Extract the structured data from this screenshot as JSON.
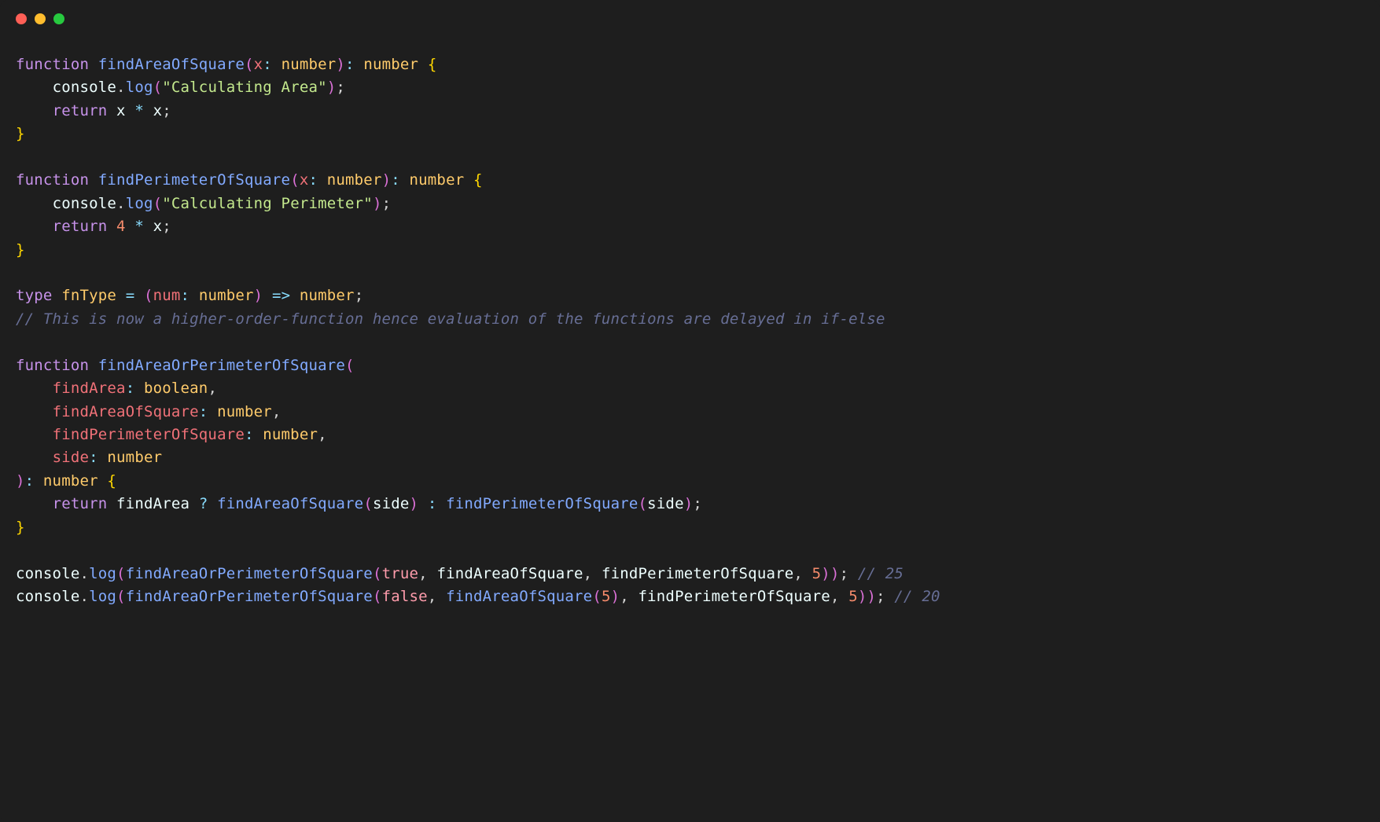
{
  "window": {
    "traffic_lights": [
      "close",
      "minimize",
      "zoom"
    ]
  },
  "code": {
    "language": "typescript",
    "lines": [
      [
        {
          "t": "function",
          "c": "kw"
        },
        {
          "t": " ",
          "c": "ws"
        },
        {
          "t": "findAreaOfSquare",
          "c": "fn"
        },
        {
          "t": "(",
          "c": "punc paren"
        },
        {
          "t": "x",
          "c": "param"
        },
        {
          "t": ":",
          "c": "op"
        },
        {
          "t": " ",
          "c": "ws"
        },
        {
          "t": "number",
          "c": "type"
        },
        {
          "t": ")",
          "c": "punc paren"
        },
        {
          "t": ":",
          "c": "op"
        },
        {
          "t": " ",
          "c": "ws"
        },
        {
          "t": "number",
          "c": "type"
        },
        {
          "t": " ",
          "c": "ws"
        },
        {
          "t": "{",
          "c": "punc brace"
        }
      ],
      [
        {
          "t": "    ",
          "c": "ws"
        },
        {
          "t": "console",
          "c": "obj"
        },
        {
          "t": ".",
          "c": "punc"
        },
        {
          "t": "log",
          "c": "fn"
        },
        {
          "t": "(",
          "c": "punc paren"
        },
        {
          "t": "\"Calculating Area\"",
          "c": "str"
        },
        {
          "t": ")",
          "c": "punc paren"
        },
        {
          "t": ";",
          "c": "punc"
        }
      ],
      [
        {
          "t": "    ",
          "c": "ws"
        },
        {
          "t": "return",
          "c": "kw"
        },
        {
          "t": " ",
          "c": "ws"
        },
        {
          "t": "x",
          "c": "var"
        },
        {
          "t": " ",
          "c": "ws"
        },
        {
          "t": "*",
          "c": "op"
        },
        {
          "t": " ",
          "c": "ws"
        },
        {
          "t": "x",
          "c": "var"
        },
        {
          "t": ";",
          "c": "punc"
        }
      ],
      [
        {
          "t": "}",
          "c": "punc brace"
        }
      ],
      [],
      [
        {
          "t": "function",
          "c": "kw"
        },
        {
          "t": " ",
          "c": "ws"
        },
        {
          "t": "findPerimeterOfSquare",
          "c": "fn"
        },
        {
          "t": "(",
          "c": "punc paren"
        },
        {
          "t": "x",
          "c": "param"
        },
        {
          "t": ":",
          "c": "op"
        },
        {
          "t": " ",
          "c": "ws"
        },
        {
          "t": "number",
          "c": "type"
        },
        {
          "t": ")",
          "c": "punc paren"
        },
        {
          "t": ":",
          "c": "op"
        },
        {
          "t": " ",
          "c": "ws"
        },
        {
          "t": "number",
          "c": "type"
        },
        {
          "t": " ",
          "c": "ws"
        },
        {
          "t": "{",
          "c": "punc brace"
        }
      ],
      [
        {
          "t": "    ",
          "c": "ws"
        },
        {
          "t": "console",
          "c": "obj"
        },
        {
          "t": ".",
          "c": "punc"
        },
        {
          "t": "log",
          "c": "fn"
        },
        {
          "t": "(",
          "c": "punc paren"
        },
        {
          "t": "\"Calculating Perimeter\"",
          "c": "str"
        },
        {
          "t": ")",
          "c": "punc paren"
        },
        {
          "t": ";",
          "c": "punc"
        }
      ],
      [
        {
          "t": "    ",
          "c": "ws"
        },
        {
          "t": "return",
          "c": "kw"
        },
        {
          "t": " ",
          "c": "ws"
        },
        {
          "t": "4",
          "c": "num"
        },
        {
          "t": " ",
          "c": "ws"
        },
        {
          "t": "*",
          "c": "op"
        },
        {
          "t": " ",
          "c": "ws"
        },
        {
          "t": "x",
          "c": "var"
        },
        {
          "t": ";",
          "c": "punc"
        }
      ],
      [
        {
          "t": "}",
          "c": "punc brace"
        }
      ],
      [],
      [
        {
          "t": "type",
          "c": "kw"
        },
        {
          "t": " ",
          "c": "ws"
        },
        {
          "t": "fnType",
          "c": "type"
        },
        {
          "t": " ",
          "c": "ws"
        },
        {
          "t": "=",
          "c": "op"
        },
        {
          "t": " ",
          "c": "ws"
        },
        {
          "t": "(",
          "c": "punc paren"
        },
        {
          "t": "num",
          "c": "param"
        },
        {
          "t": ":",
          "c": "op"
        },
        {
          "t": " ",
          "c": "ws"
        },
        {
          "t": "number",
          "c": "type"
        },
        {
          "t": ")",
          "c": "punc paren"
        },
        {
          "t": " ",
          "c": "ws"
        },
        {
          "t": "=>",
          "c": "op"
        },
        {
          "t": " ",
          "c": "ws"
        },
        {
          "t": "number",
          "c": "type"
        },
        {
          "t": ";",
          "c": "punc"
        }
      ],
      [
        {
          "t": "// This is now a higher-order-function hence evaluation of the functions are delayed in if-else",
          "c": "comment"
        }
      ],
      [],
      [
        {
          "t": "function",
          "c": "kw"
        },
        {
          "t": " ",
          "c": "ws"
        },
        {
          "t": "findAreaOrPerimeterOfSquare",
          "c": "fn"
        },
        {
          "t": "(",
          "c": "punc paren"
        }
      ],
      [
        {
          "t": "    ",
          "c": "ws"
        },
        {
          "t": "findArea",
          "c": "param"
        },
        {
          "t": ":",
          "c": "op"
        },
        {
          "t": " ",
          "c": "ws"
        },
        {
          "t": "boolean",
          "c": "type"
        },
        {
          "t": ",",
          "c": "punc"
        }
      ],
      [
        {
          "t": "    ",
          "c": "ws"
        },
        {
          "t": "findAreaOfSquare",
          "c": "param"
        },
        {
          "t": ":",
          "c": "op"
        },
        {
          "t": " ",
          "c": "ws"
        },
        {
          "t": "number",
          "c": "type"
        },
        {
          "t": ",",
          "c": "punc"
        }
      ],
      [
        {
          "t": "    ",
          "c": "ws"
        },
        {
          "t": "findPerimeterOfSquare",
          "c": "param"
        },
        {
          "t": ":",
          "c": "op"
        },
        {
          "t": " ",
          "c": "ws"
        },
        {
          "t": "number",
          "c": "type"
        },
        {
          "t": ",",
          "c": "punc"
        }
      ],
      [
        {
          "t": "    ",
          "c": "ws"
        },
        {
          "t": "side",
          "c": "param"
        },
        {
          "t": ":",
          "c": "op"
        },
        {
          "t": " ",
          "c": "ws"
        },
        {
          "t": "number",
          "c": "type"
        }
      ],
      [
        {
          "t": ")",
          "c": "punc paren"
        },
        {
          "t": ":",
          "c": "op"
        },
        {
          "t": " ",
          "c": "ws"
        },
        {
          "t": "number",
          "c": "type"
        },
        {
          "t": " ",
          "c": "ws"
        },
        {
          "t": "{",
          "c": "punc brace"
        }
      ],
      [
        {
          "t": "    ",
          "c": "ws"
        },
        {
          "t": "return",
          "c": "kw"
        },
        {
          "t": " ",
          "c": "ws"
        },
        {
          "t": "findArea",
          "c": "var"
        },
        {
          "t": " ",
          "c": "ws"
        },
        {
          "t": "?",
          "c": "op"
        },
        {
          "t": " ",
          "c": "ws"
        },
        {
          "t": "findAreaOfSquare",
          "c": "fn"
        },
        {
          "t": "(",
          "c": "punc paren"
        },
        {
          "t": "side",
          "c": "var"
        },
        {
          "t": ")",
          "c": "punc paren"
        },
        {
          "t": " ",
          "c": "ws"
        },
        {
          "t": ":",
          "c": "op"
        },
        {
          "t": " ",
          "c": "ws"
        },
        {
          "t": "findPerimeterOfSquare",
          "c": "fn"
        },
        {
          "t": "(",
          "c": "punc paren"
        },
        {
          "t": "side",
          "c": "var"
        },
        {
          "t": ")",
          "c": "punc paren"
        },
        {
          "t": ";",
          "c": "punc"
        }
      ],
      [
        {
          "t": "}",
          "c": "punc brace"
        }
      ],
      [],
      [
        {
          "t": "console",
          "c": "obj"
        },
        {
          "t": ".",
          "c": "punc"
        },
        {
          "t": "log",
          "c": "fn"
        },
        {
          "t": "(",
          "c": "punc paren"
        },
        {
          "t": "findAreaOrPerimeterOfSquare",
          "c": "fn"
        },
        {
          "t": "(",
          "c": "punc paren"
        },
        {
          "t": "true",
          "c": "bool"
        },
        {
          "t": ",",
          "c": "punc"
        },
        {
          "t": " ",
          "c": "ws"
        },
        {
          "t": "findAreaOfSquare",
          "c": "var"
        },
        {
          "t": ",",
          "c": "punc"
        },
        {
          "t": " ",
          "c": "ws"
        },
        {
          "t": "findPerimeterOfSquare",
          "c": "var"
        },
        {
          "t": ",",
          "c": "punc"
        },
        {
          "t": " ",
          "c": "ws"
        },
        {
          "t": "5",
          "c": "num"
        },
        {
          "t": ")",
          "c": "punc paren"
        },
        {
          "t": ")",
          "c": "punc paren"
        },
        {
          "t": ";",
          "c": "punc"
        },
        {
          "t": " ",
          "c": "ws"
        },
        {
          "t": "// 25",
          "c": "comment"
        }
      ],
      [
        {
          "t": "console",
          "c": "obj"
        },
        {
          "t": ".",
          "c": "punc"
        },
        {
          "t": "log",
          "c": "fn"
        },
        {
          "t": "(",
          "c": "punc paren"
        },
        {
          "t": "findAreaOrPerimeterOfSquare",
          "c": "fn"
        },
        {
          "t": "(",
          "c": "punc paren"
        },
        {
          "t": "false",
          "c": "bool"
        },
        {
          "t": ",",
          "c": "punc"
        },
        {
          "t": " ",
          "c": "ws"
        },
        {
          "t": "findAreaOfSquare",
          "c": "fn"
        },
        {
          "t": "(",
          "c": "punc paren"
        },
        {
          "t": "5",
          "c": "num"
        },
        {
          "t": ")",
          "c": "punc paren"
        },
        {
          "t": ",",
          "c": "punc"
        },
        {
          "t": " ",
          "c": "ws"
        },
        {
          "t": "findPerimeterOfSquare",
          "c": "var"
        },
        {
          "t": ",",
          "c": "punc"
        },
        {
          "t": " ",
          "c": "ws"
        },
        {
          "t": "5",
          "c": "num"
        },
        {
          "t": ")",
          "c": "punc paren"
        },
        {
          "t": ")",
          "c": "punc paren"
        },
        {
          "t": ";",
          "c": "punc"
        },
        {
          "t": " ",
          "c": "ws"
        },
        {
          "t": "// 20",
          "c": "comment"
        }
      ]
    ]
  }
}
